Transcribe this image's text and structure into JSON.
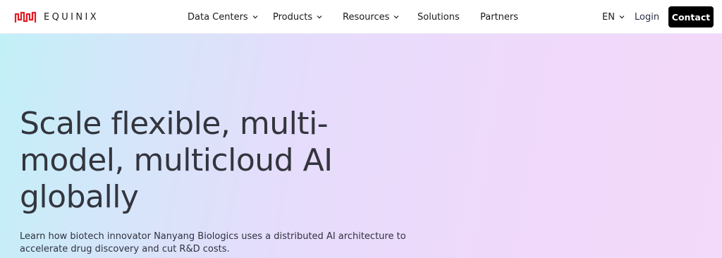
{
  "header": {
    "logo_text": "EQUINIX",
    "nav": [
      {
        "label": "Data Centers",
        "has_dropdown": true
      },
      {
        "label": "Products",
        "has_dropdown": true
      },
      {
        "label": "Resources",
        "has_dropdown": true
      },
      {
        "label": "Solutions",
        "has_dropdown": false
      },
      {
        "label": "Partners",
        "has_dropdown": false
      }
    ],
    "language": "EN",
    "login_label": "Login",
    "contact_label": "Contact"
  },
  "hero": {
    "title": "Scale flexible, multi-model, multicloud AI globally",
    "subtitle": "Learn how biotech innovator Nanyang Biologics uses a distributed AI architecture to accelerate drug discovery and cut R&D costs."
  },
  "colors": {
    "brand": "#e31b23",
    "contact_bg": "#000000",
    "gradient_start": "#c2f0f7",
    "gradient_end": "#f3d9fa"
  },
  "icons": {
    "logo": "equinix-logo-icon",
    "dropdown": "chevron-down-icon"
  }
}
